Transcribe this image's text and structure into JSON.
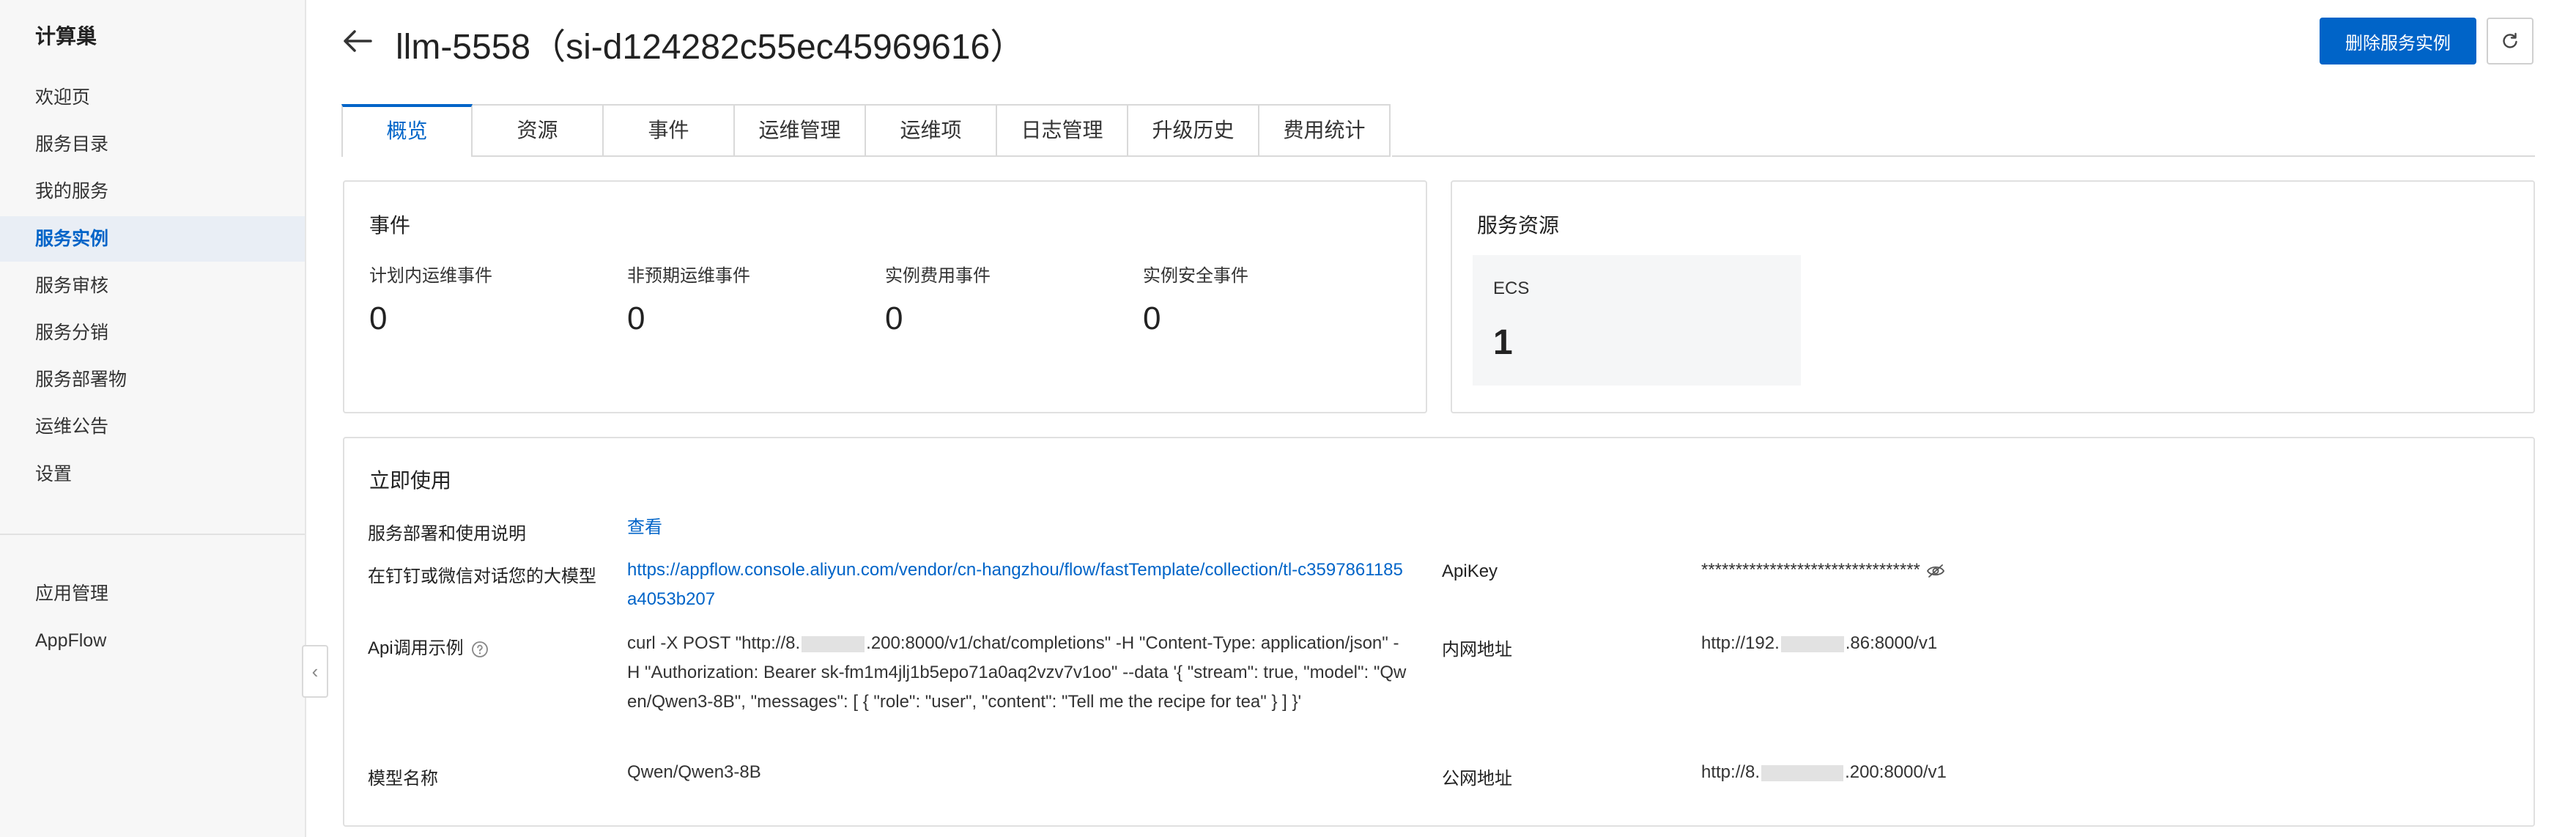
{
  "sidebar": {
    "title": "计算巢",
    "items": [
      {
        "label": "欢迎页"
      },
      {
        "label": "服务目录"
      },
      {
        "label": "我的服务"
      },
      {
        "label": "服务实例"
      },
      {
        "label": "服务审核"
      },
      {
        "label": "服务分销"
      },
      {
        "label": "服务部署物"
      },
      {
        "label": "运维公告"
      },
      {
        "label": "设置"
      }
    ],
    "active_index": 3,
    "bottom_items": [
      {
        "label": "应用管理"
      },
      {
        "label": "AppFlow"
      }
    ]
  },
  "header": {
    "title": "llm-5558（si-d124282c55ec45969616）",
    "delete_button": "删除服务实例"
  },
  "tabs": [
    {
      "label": "概览"
    },
    {
      "label": "资源"
    },
    {
      "label": "事件"
    },
    {
      "label": "运维管理"
    },
    {
      "label": "运维项"
    },
    {
      "label": "日志管理"
    },
    {
      "label": "升级历史"
    },
    {
      "label": "费用统计"
    }
  ],
  "active_tab": 0,
  "events": {
    "title": "事件",
    "stats": [
      {
        "label": "计划内运维事件",
        "value": "0"
      },
      {
        "label": "非预期运维事件",
        "value": "0"
      },
      {
        "label": "实例费用事件",
        "value": "0"
      },
      {
        "label": "实例安全事件",
        "value": "0"
      }
    ]
  },
  "resources": {
    "title": "服务资源",
    "ecs_label": "ECS",
    "ecs_value": "1"
  },
  "usage": {
    "title": "立即使用",
    "deploy_doc_label": "服务部署和使用说明",
    "deploy_doc_link": "查看",
    "chat_label": "在钉钉或微信对话您的大模型",
    "chat_url": "https://appflow.console.aliyun.com/vendor/cn-hangzhou/flow/fastTemplate/collection/tl-c3597861185a4053b207",
    "api_example_label": "Api调用示例",
    "api_example_prefix": "curl -X POST \"http://8.",
    "api_example_suffix": ".200:8000/v1/chat/completions\" -H \"Content-Type: application/json\" -H \"Authorization: Bearer sk-fm1m4jlj1b5epo71a0aq2vzv7v1oo\" --data '{ \"stream\": true, \"model\": \"Qwen/Qwen3-8B\",  \"messages\": [ { \"role\": \"user\", \"content\": \"Tell me the recipe for tea\" } ] }'",
    "model_name_label": "模型名称",
    "model_name_value": "Qwen/Qwen3-8B",
    "apikey_label": "ApiKey",
    "apikey_value": "********************************",
    "intranet_label": "内网地址",
    "intranet_prefix": "http://192.",
    "intranet_suffix": ".86:8000/v1",
    "public_label": "公网地址",
    "public_prefix": "http://8.",
    "public_suffix": ".200:8000/v1"
  },
  "colors": {
    "accent": "#0064c8",
    "sidebar_bg": "#f7f7f7",
    "active_nav_bg": "#e9eef5"
  }
}
